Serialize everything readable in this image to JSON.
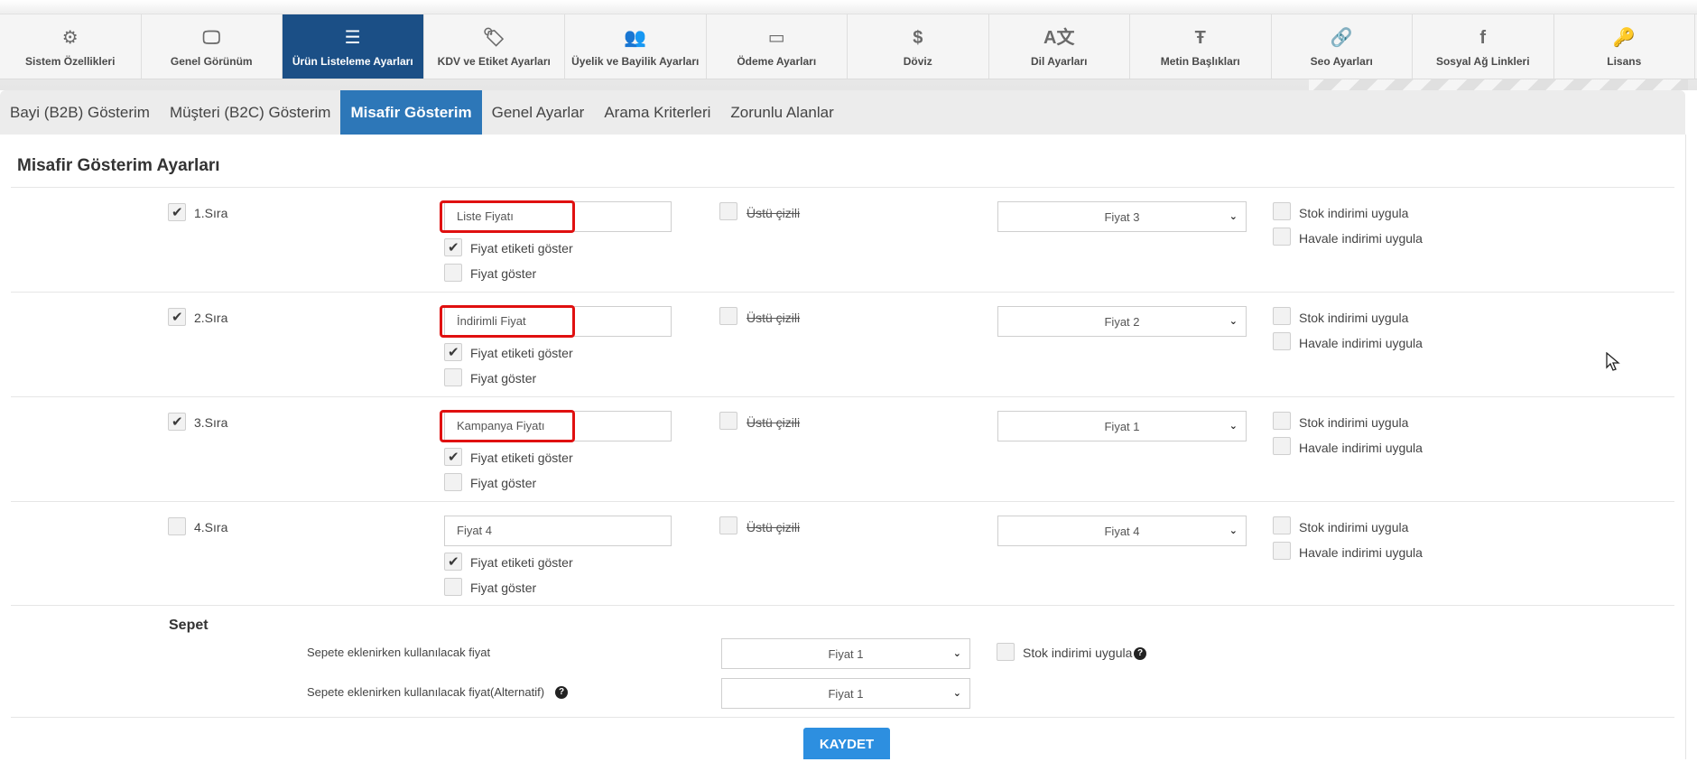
{
  "topnav": [
    {
      "label": "Sistem Özellikleri",
      "icon": "gears-icon",
      "glyph": "⚙"
    },
    {
      "label": "Genel Görünüm",
      "icon": "monitor-icon",
      "glyph": "🖵"
    },
    {
      "label": "Ürün Listeleme Ayarları",
      "icon": "list-icon",
      "glyph": "☰",
      "active": true
    },
    {
      "label": "KDV ve Etiket Ayarları",
      "icon": "tags-icon",
      "glyph": "🏷"
    },
    {
      "label": "Üyelik ve Bayilik Ayarları",
      "icon": "users-icon",
      "glyph": "👥"
    },
    {
      "label": "Ödeme Ayarları",
      "icon": "credit-card-icon",
      "glyph": "▭"
    },
    {
      "label": "Döviz",
      "icon": "dollar-icon",
      "glyph": "$"
    },
    {
      "label": "Dil Ayarları",
      "icon": "language-icon",
      "glyph": "A文"
    },
    {
      "label": "Metin Başlıkları",
      "icon": "text-height-icon",
      "glyph": "Ŧ"
    },
    {
      "label": "Seo Ayarları",
      "icon": "link-icon",
      "glyph": "🔗"
    },
    {
      "label": "Sosyal Ağ Linkleri",
      "icon": "facebook-icon",
      "glyph": "f"
    },
    {
      "label": "Lisans",
      "icon": "key-icon",
      "glyph": "🔑"
    }
  ],
  "subtabs": [
    {
      "label": "Bayi (B2B) Gösterim"
    },
    {
      "label": "Müşteri (B2C) Gösterim"
    },
    {
      "label": "Misafir Gösterim",
      "active": true
    },
    {
      "label": "Genel Ayarlar"
    },
    {
      "label": "Arama Kriterleri"
    },
    {
      "label": "Zorunlu Alanlar"
    }
  ],
  "section_title": "Misafir Gösterim Ayarları",
  "labels": {
    "show_label": "Fiyat etiketi göster",
    "show_price": "Fiyat göster",
    "strike": "Üstü çizili",
    "stock_discount": "Stok indirimi uygula",
    "transfer_discount": "Havale indirimi uygula"
  },
  "rows": [
    {
      "label": "1.Sıra",
      "enabled": true,
      "name": "Liste Fiyatı",
      "highlight": true,
      "show_label": true,
      "show_price": false,
      "strike": false,
      "price": "Fiyat 3",
      "stock": false,
      "transfer": false
    },
    {
      "label": "2.Sıra",
      "enabled": true,
      "name": "İndirimli Fiyat",
      "highlight": true,
      "show_label": true,
      "show_price": false,
      "strike": false,
      "price": "Fiyat 2",
      "stock": false,
      "transfer": false
    },
    {
      "label": "3.Sıra",
      "enabled": true,
      "name": "Kampanya Fiyatı",
      "highlight": true,
      "show_label": true,
      "show_price": false,
      "strike": false,
      "price": "Fiyat 1",
      "stock": false,
      "transfer": false
    },
    {
      "label": "4.Sıra",
      "enabled": false,
      "name": "Fiyat 4",
      "highlight": false,
      "show_label": true,
      "show_price": false,
      "strike": false,
      "price": "Fiyat 4",
      "stock": false,
      "transfer": false
    }
  ],
  "sepet": {
    "title": "Sepet",
    "price_label": "Sepete eklenirken kullanılacak fiyat",
    "price_value": "Fiyat 1",
    "alt_label": "Sepete eklenirken kullanılacak fiyat(Alternatif)",
    "alt_value": "Fiyat 1",
    "stock_label": "Stok indirimi uygula",
    "stock": false
  },
  "save_label": "KAYDET",
  "colors": {
    "active_nav": "#1b4f86",
    "active_tab": "#2d77b8",
    "save": "#2d8fe0",
    "highlight": "#e01010"
  }
}
